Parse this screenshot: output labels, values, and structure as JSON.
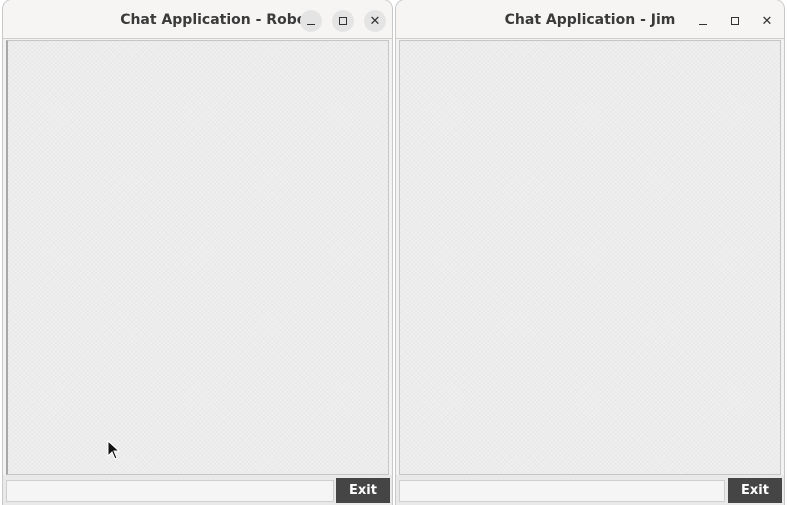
{
  "windows": [
    {
      "title": "Chat Application - Robert",
      "message_input": {
        "value": "",
        "placeholder": ""
      },
      "exit_label": "Exit"
    },
    {
      "title": "Chat Application - Jim",
      "message_input": {
        "value": "",
        "placeholder": ""
      },
      "exit_label": "Exit"
    }
  ],
  "icons": {
    "minimize": "minimize-icon",
    "maximize": "maximize-icon",
    "close": "close-icon",
    "cursor": "mouse-pointer-icon"
  },
  "colors": {
    "exit_button_bg": "#454545",
    "exit_button_text": "#ffffff",
    "chat_background": "#efefef",
    "titlebar_bg": "#f6f5f4"
  }
}
